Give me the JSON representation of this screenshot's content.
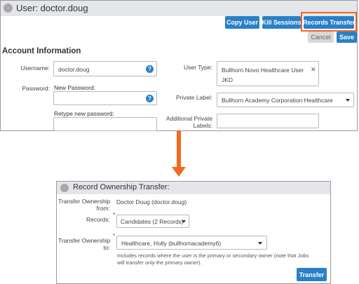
{
  "user_panel": {
    "title": "User: doctor.doug",
    "buttons": {
      "copy_user": "Copy User",
      "kill_sessions": "Kill Sessions",
      "records_transfer": "Records Transfer",
      "cancel": "Cancel",
      "save": "Save"
    },
    "section_title": "Account Information",
    "username_label": "Username:",
    "username_value": "doctor.doug",
    "password_label": "Password:",
    "new_password_label": "New Password:",
    "new_password_value": "",
    "retype_password_label": "Retype new password:",
    "retype_password_value": "",
    "user_type_label": "User Type:",
    "user_type_value_line1": "Bullhorn Novo Healthcare User",
    "user_type_value_line2": "JKD",
    "private_label_label": "Private Label:",
    "private_label_value": "Bullhorn Academy Corporation Healthcare",
    "additional_labels_label_line1": "Additional Private",
    "additional_labels_label_line2": "Labels:",
    "additional_labels_value": ""
  },
  "transfer_panel": {
    "title": "Record Ownership Transfer:",
    "transfer_from_label_line1": "Transfer Ownership",
    "transfer_from_label_line2": "from:",
    "transfer_from_value": "Doctor Doug (doctor.doug)",
    "records_label": "Records:",
    "records_value": "Candidates (2 Records)",
    "transfer_to_label_line1": "Transfer Ownership",
    "transfer_to_label_line2": "to:",
    "transfer_to_value": "Healthcare, Holly (bullhornacademy6)",
    "help_text_line1": "Includes records where the user is the primary or secondary owner (note that Jobs",
    "help_text_line2": "will transfer only the primary owner).",
    "transfer_button": "Transfer",
    "required_mark": "*"
  },
  "icons": {
    "help": "?",
    "clear": "✕"
  },
  "colors": {
    "accent_blue": "#2a80c8",
    "highlight_orange": "#f26522",
    "arrow_orange": "#f26b1d",
    "title_bar_gray": "#e4e6e9",
    "required_red": "#d0021b"
  }
}
